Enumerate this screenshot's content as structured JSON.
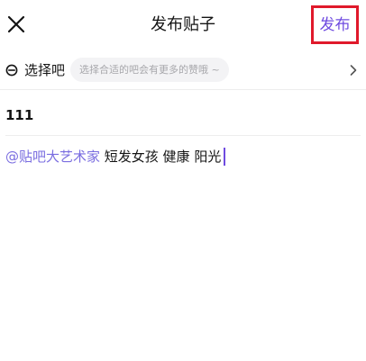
{
  "header": {
    "close_icon": "close-icon",
    "title": "发布贴子",
    "publish_label": "发布",
    "publish_highlight_color": "#e0192b",
    "accent_color": "#6f4be0"
  },
  "bar_select": {
    "icon": "minus-circle-icon",
    "label": "选择吧",
    "hint": "选择合适的吧会有更多的赞哦 ~",
    "chevron_icon": "chevron-right-icon"
  },
  "post": {
    "title": "111",
    "content_mention": "@贴吧大艺术家",
    "content_text": " 短发女孩 健康 阳光",
    "mention_color": "#7a6de0"
  }
}
